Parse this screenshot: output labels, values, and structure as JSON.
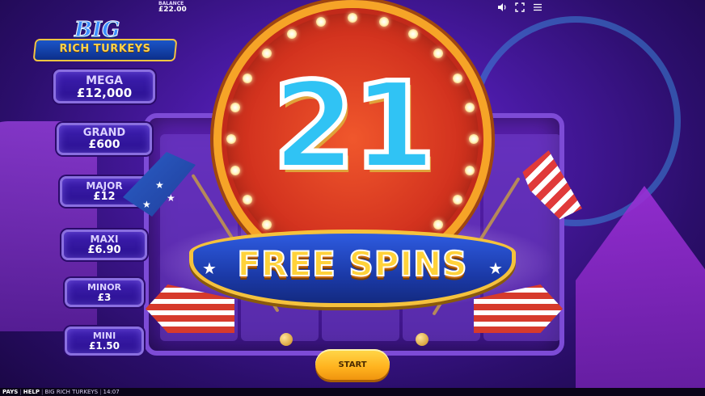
{
  "game": {
    "logo_top": "BIG",
    "logo_bottom": "RICH TURKEYS"
  },
  "balance": {
    "label": "BALANCE",
    "value": "£22.00"
  },
  "controls": {
    "sound_icon": "speaker-icon",
    "fullscreen_icon": "fullscreen-icon",
    "menu_icon": "menu-icon"
  },
  "jackpots": [
    {
      "name": "MEGA",
      "value": "£12,000"
    },
    {
      "name": "GRAND",
      "value": "£600"
    },
    {
      "name": "MAJOR",
      "value": "£12"
    },
    {
      "name": "MAXI",
      "value": "£6.90"
    },
    {
      "name": "MINOR",
      "value": "£3"
    },
    {
      "name": "MINI",
      "value": "£1.50"
    }
  ],
  "award": {
    "count": "21",
    "label": "FREE SPINS"
  },
  "start_button": {
    "label": "START"
  },
  "footer": {
    "pays": "PAYS",
    "help": "HELP",
    "game_name": "BIG RICH TURKEYS",
    "time": "14:07"
  },
  "colors": {
    "background": "#2a0f5c",
    "marquee_red": "#d4341f",
    "marquee_rim": "#f6a427",
    "number_cyan": "#30c3f4",
    "ribbon_blue": "#1b3aa8",
    "gold_text": "#ffd23a",
    "button_yellow": "#ffb21e"
  }
}
